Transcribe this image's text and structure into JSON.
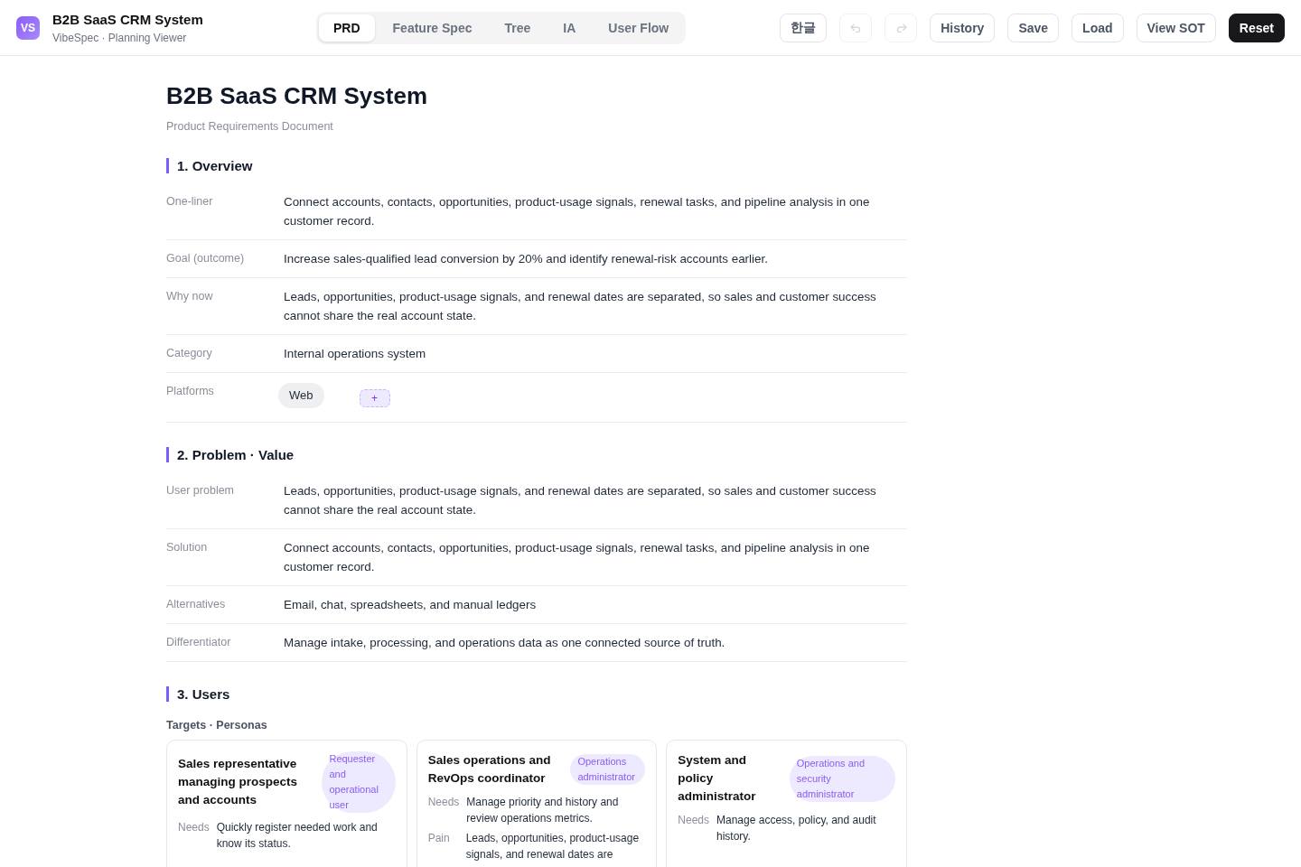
{
  "header": {
    "logo": "VS",
    "title": "B2B SaaS CRM System",
    "subtitle": "VibeSpec · Planning Viewer"
  },
  "tabs": [
    {
      "label": "PRD",
      "selected": true
    },
    {
      "label": "Feature Spec",
      "selected": false
    },
    {
      "label": "Tree",
      "selected": false
    },
    {
      "label": "IA",
      "selected": false
    },
    {
      "label": "User Flow",
      "selected": false
    }
  ],
  "toolbar": {
    "language_button": "한글",
    "history_controls": [
      {
        "kind": "undo",
        "disabled": true
      },
      {
        "kind": "redo",
        "disabled": true
      }
    ],
    "actions": [
      {
        "label": "History",
        "kind": "outline"
      },
      {
        "label": "Save",
        "kind": "outline"
      },
      {
        "label": "Load",
        "kind": "outline"
      },
      {
        "label": "View SOT",
        "kind": "outline"
      },
      {
        "label": "Reset",
        "kind": "solid"
      }
    ]
  },
  "document": {
    "title": "B2B SaaS CRM System",
    "subtitle": "Product Requirements Document",
    "sections": [
      {
        "kind": "fields",
        "heading": "1. Overview",
        "fields": [
          {
            "kind": "text",
            "label": "One-liner",
            "value": "Connect accounts, contacts, opportunities, product-usage signals, renewal tasks, and pipeline analysis in one customer record."
          },
          {
            "kind": "text",
            "label": "Goal (outcome)",
            "value": "Increase sales-qualified lead conversion by 20% and identify renewal-risk accounts earlier."
          },
          {
            "kind": "text",
            "label": "Why now",
            "value": "Leads, opportunities, product-usage signals, and renewal dates are separated, so sales and customer success cannot share the real account state."
          },
          {
            "kind": "text",
            "label": "Category",
            "value": "Internal operations system"
          },
          {
            "kind": "chips",
            "label": "Platforms",
            "chips": [
              "Web"
            ],
            "add_button": "+"
          }
        ]
      },
      {
        "kind": "fields",
        "heading": "2. Problem · Value",
        "fields": [
          {
            "kind": "text",
            "label": "User problem",
            "value": "Leads, opportunities, product-usage signals, and renewal dates are separated, so sales and customer success cannot share the real account state."
          },
          {
            "kind": "text",
            "label": "Solution",
            "value": "Connect accounts, contacts, opportunities, product-usage signals, renewal tasks, and pipeline analysis in one customer record."
          },
          {
            "kind": "text",
            "label": "Alternatives",
            "value": "Email, chat, spreadsheets, and manual ledgers"
          },
          {
            "kind": "text",
            "label": "Differentiator",
            "value": "Manage intake, processing, and operations data as one connected source of truth."
          }
        ]
      },
      {
        "kind": "personas",
        "heading": "3. Users",
        "subheading": "Targets · Personas",
        "personas": [
          {
            "name": "Sales representative managing prospects and accounts",
            "role": "Requester and operational user",
            "details": [
              {
                "label": "Needs",
                "value": "Quickly register needed work and know its status."
              }
            ]
          },
          {
            "name": "Sales operations and RevOps coordinator",
            "role": "Operations administrator",
            "details": [
              {
                "label": "Needs",
                "value": "Manage priority and history and review operations metrics."
              },
              {
                "label": "Pain",
                "value": "Leads, opportunities, product-usage signals, and renewal dates are"
              }
            ]
          },
          {
            "name": "System and policy administrator",
            "role": "Operations and security administrator",
            "details": [
              {
                "label": "Needs",
                "value": "Manage access, policy, and audit history."
              }
            ]
          }
        ]
      }
    ]
  }
}
